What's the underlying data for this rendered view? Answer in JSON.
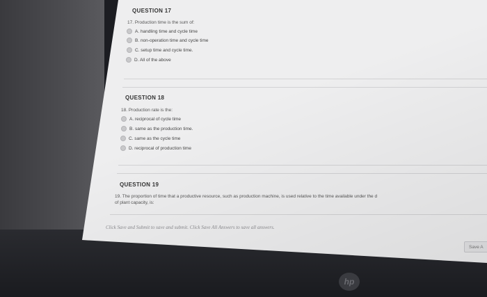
{
  "questions": [
    {
      "heading": "QUESTION 17",
      "prompt": "17. Production time is the sum of:",
      "options": [
        "A. handling time and cycle time",
        "B. non-operation time and cycle time",
        "C. setup time and cycle time.",
        "D. All of the above"
      ]
    },
    {
      "heading": "QUESTION 18",
      "prompt": "18. Production rate is the:",
      "options": [
        "A. reciprocal of cycle time",
        "B. same as the production time.",
        "C. same as the cycle time",
        "D. reciprocal of production time"
      ]
    },
    {
      "heading": "QUESTION 19",
      "prompt_line1": "19. The proportion of time that a productive resource, such as production machine, is used relative to the time available under the d",
      "prompt_line2": "of plant capacity, is:"
    }
  ],
  "footer": {
    "note": "Click Save and Submit to save and submit. Click Save All Answers to save all answers.",
    "save_button": "Save A"
  },
  "brand": {
    "logo_text": "hp"
  }
}
